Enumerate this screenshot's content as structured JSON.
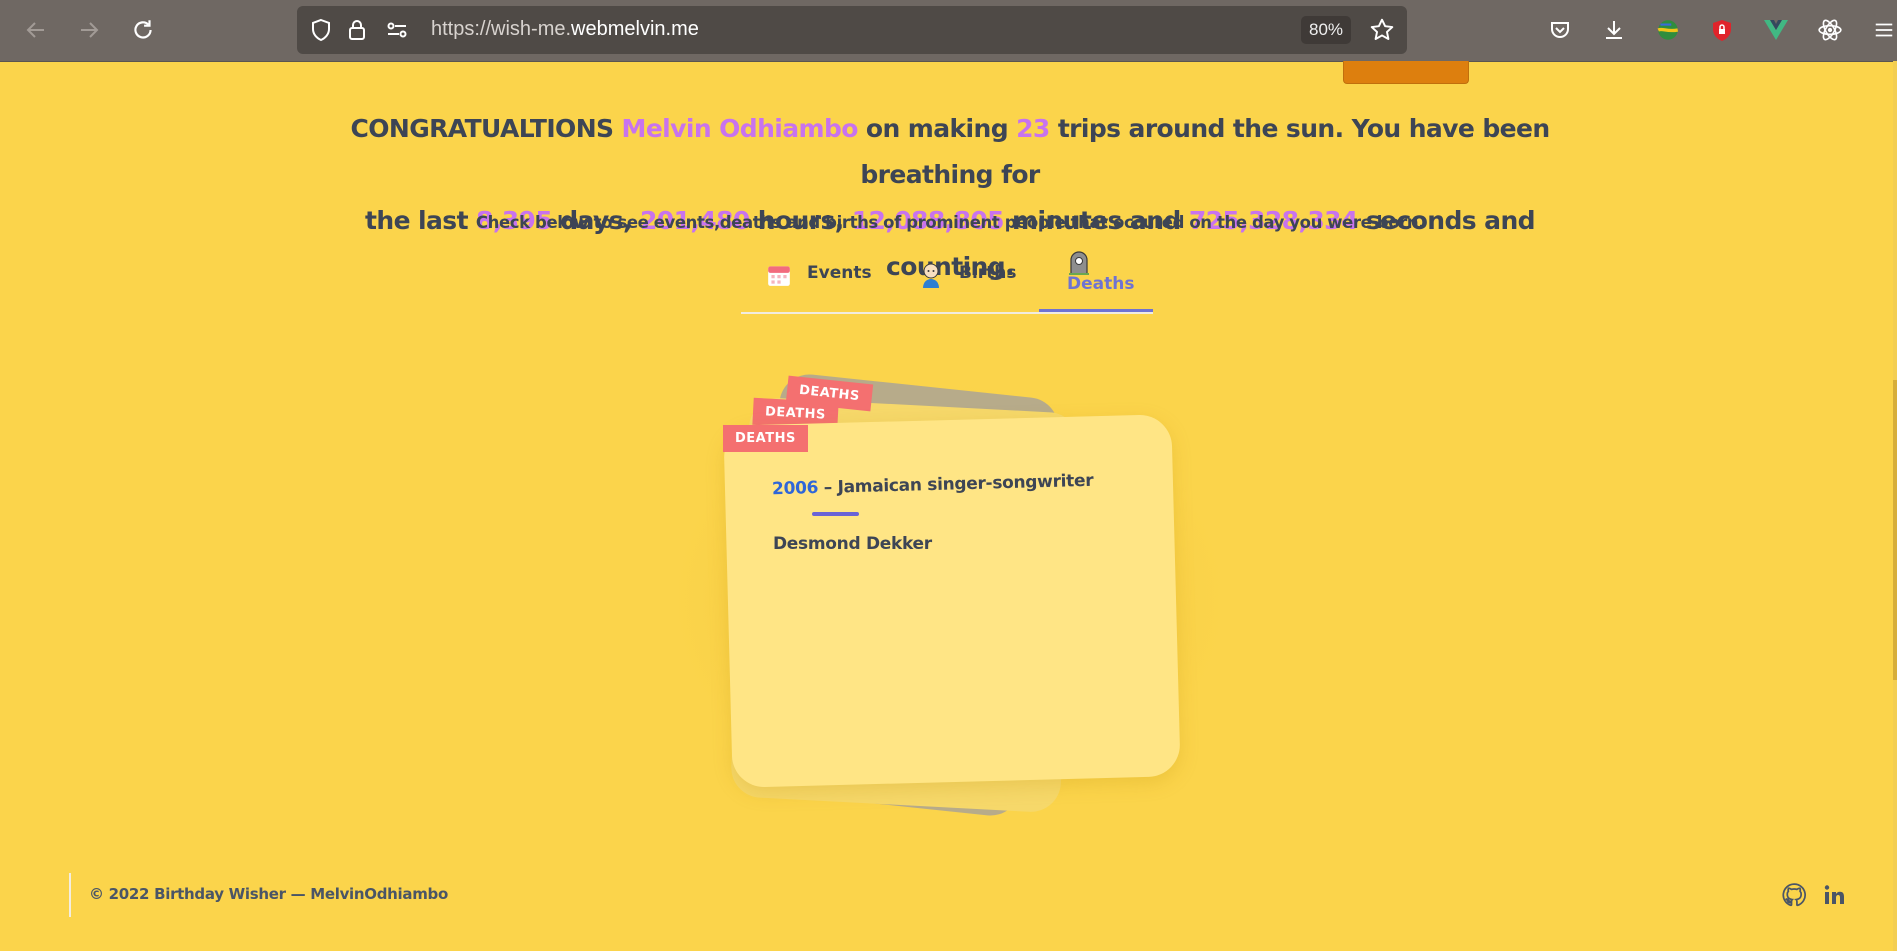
{
  "browser": {
    "url_prefix": "https://wish-me.",
    "url_domain": "webmelvin.me",
    "zoom": "80%",
    "icons": [
      "back-icon",
      "forward-icon",
      "reload-icon",
      "shield-icon",
      "lock-icon",
      "permissions-icon",
      "bookmark-star-icon",
      "pocket-icon",
      "download-icon",
      "extension-globe-icon",
      "extension-shield-icon",
      "vue-devtools-icon",
      "react-devtools-icon",
      "menu-icon"
    ]
  },
  "headline": {
    "t1": "CONGRATUALTIONS ",
    "name": "Melvin Odhiambo",
    "t2": " on making ",
    "trips": "23",
    "t3": " trips around the sun. You have been breathing for",
    "t4": "the last ",
    "days": "8,395",
    "t5": " days, ",
    "hours": "201,480",
    "t6": " hours, ",
    "minutes": "12,088,805",
    "t7": " minutes and ",
    "seconds": "725,328,334",
    "t8": " seconds and counting."
  },
  "subtitle": "Check below to see events,deaths and births of prominent people that occured on the day you were born.",
  "tabs": [
    {
      "label": "Events",
      "icon": "calendar-icon"
    },
    {
      "label": "Births",
      "icon": "baby-icon"
    },
    {
      "label": "Deaths",
      "icon": "grave-icon",
      "active": true
    }
  ],
  "card": {
    "tags": [
      "DEATHS",
      "DEATHS",
      "DEATHS"
    ],
    "year": "2006",
    "sep": " – ",
    "description": "Jamaican singer-songwriter",
    "name": "Desmond Dekker"
  },
  "footer": {
    "copyright": "© 2022 Birthday Wisher — MelvinOdhiambo",
    "social": [
      "github-icon",
      "linkedin-icon"
    ]
  },
  "colors": {
    "page_bg": "#fbd44b",
    "accent_pink": "#e8307d",
    "accent_violet": "#c873ee",
    "tag_red": "#f47070",
    "card_bg": "#ffe585",
    "active_tab": "#6f73d2",
    "year_blue": "#2f66d8"
  }
}
